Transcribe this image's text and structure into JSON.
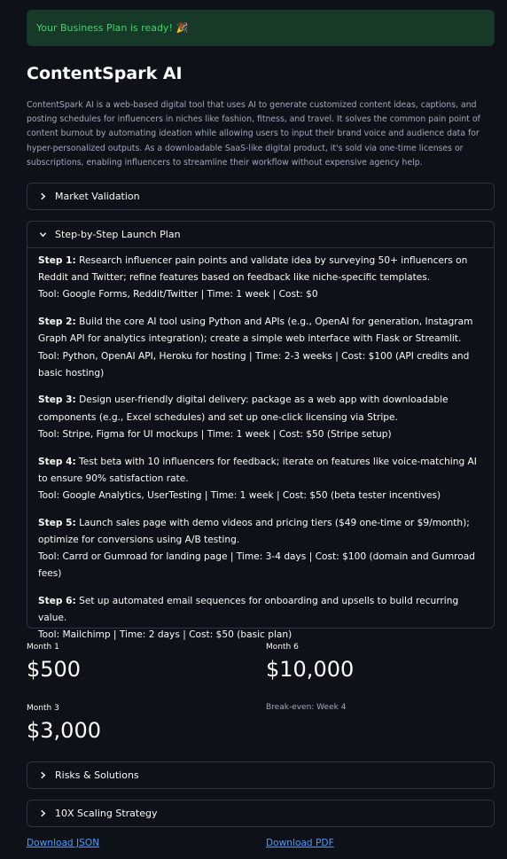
{
  "alert": {
    "text": "Your Business Plan is ready!",
    "emoji": "🎉"
  },
  "app": {
    "title": "ContentSpark AI",
    "description": "ContentSpark AI is a web-based digital tool that uses AI to generate customized content ideas, captions, and posting schedules for influencers in niches like fashion, fitness, and travel. It solves the common pain point of content burnout by automating ideation while allowing users to input their brand voice and audience data for hyper-personalized outputs. As a downloadable SaaS-like digital product, it's sold via one-time licenses or subscriptions, enabling influencers to streamline their workflow without expensive agency help."
  },
  "expanders": {
    "market_validation": "Market Validation",
    "launch_plan": "Step-by-Step Launch Plan",
    "risks": "Risks & Solutions",
    "scaling": "10X Scaling Strategy"
  },
  "steps": [
    {
      "label": "Step 1:",
      "text": "Research influencer pain points and validate idea by surveying 50+ influencers on Reddit and Twitter; refine features based on feedback like niche-specific templates.",
      "tool": "Tool: Google Forms, Reddit/Twitter | Time: 1 week | Cost: $0"
    },
    {
      "label": "Step 2:",
      "text": "Build the core AI tool using Python and APIs (e.g., OpenAI for generation, Instagram Graph API for analytics integration); create a simple web interface with Flask or Streamlit.",
      "tool": "Tool: Python, OpenAI API, Heroku for hosting | Time: 2-3 weeks | Cost: $100 (API credits and basic hosting)"
    },
    {
      "label": "Step 3:",
      "text": "Design user-friendly digital delivery: package as a web app with downloadable components (e.g., Excel schedules) and set up one-click licensing via Stripe.",
      "tool": "Tool: Stripe, Figma for UI mockups | Time: 1 week | Cost: $50 (Stripe setup)"
    },
    {
      "label": "Step 4:",
      "text": "Test beta with 10 influencers for feedback; iterate on features like voice-matching AI to ensure 90% satisfaction rate.",
      "tool": "Tool: Google Analytics, UserTesting | Time: 1 week | Cost: $50 (beta tester incentives)"
    },
    {
      "label": "Step 5:",
      "text": "Launch sales page with demo videos and pricing tiers ($49 one-time or $9/month); optimize for conversions using A/B testing.",
      "tool": "Tool: Carrd or Gumroad for landing page | Time: 3-4 days | Cost: $100 (domain and Gumroad fees)"
    },
    {
      "label": "Step 6:",
      "text": "Set up automated email sequences for onboarding and upsells to build recurring value.",
      "tool": "Tool: Mailchimp | Time: 2 days | Cost: $50 (basic plan)"
    }
  ],
  "metrics": {
    "month1": {
      "label": "Month 1",
      "value": "$500"
    },
    "month3": {
      "label": "Month 3",
      "value": "$3,000"
    },
    "month6": {
      "label": "Month 6",
      "value": "$10,000"
    },
    "breakeven": "Break-even: Week 4"
  },
  "downloads": {
    "json": "Download JSON",
    "pdf": "Download PDF"
  },
  "icons": {
    "collapsed": "chevron-right-icon",
    "expanded": "chevron-down-icon"
  },
  "colors": {
    "background": "#0e1117",
    "success_bg": "#173928",
    "success_text": "#3dd56d",
    "link": "#4d9cf8"
  }
}
